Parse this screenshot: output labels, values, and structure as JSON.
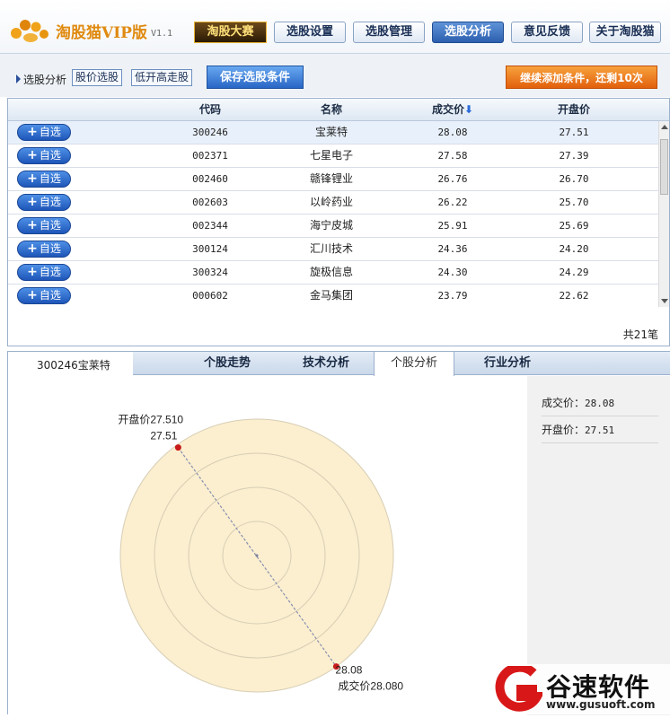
{
  "app": {
    "title": "淘股猫VIP版",
    "version": "V1.1",
    "contest_label": "淘股大赛",
    "nav": [
      {
        "label": "选股设置",
        "active": false
      },
      {
        "label": "选股管理",
        "active": false
      },
      {
        "label": "选股分析",
        "active": true
      },
      {
        "label": "意见反馈",
        "active": false
      },
      {
        "label": "关于淘股猫",
        "active": false
      }
    ]
  },
  "toolbar": {
    "label": "选股分析",
    "tags": [
      "股价选股",
      "低开高走股"
    ],
    "save_label": "保存选股条件",
    "add_condition_label": "继续添加条件，还剩10次"
  },
  "table": {
    "columns": {
      "code": "代码",
      "name": "名称",
      "price": "成交价",
      "open": "开盘价"
    },
    "sort_indicator": "⬇",
    "add_label": "自选",
    "add_icon": "plus-icon",
    "rows": [
      {
        "code": "300246",
        "name": "宝莱特",
        "price": "28.08",
        "open": "27.51"
      },
      {
        "code": "002371",
        "name": "七星电子",
        "price": "27.58",
        "open": "27.39"
      },
      {
        "code": "002460",
        "name": "赣锋锂业",
        "price": "26.76",
        "open": "26.70"
      },
      {
        "code": "002603",
        "name": "以岭药业",
        "price": "26.22",
        "open": "25.70"
      },
      {
        "code": "002344",
        "name": "海宁皮城",
        "price": "25.91",
        "open": "25.69"
      },
      {
        "code": "300124",
        "name": "汇川技术",
        "price": "24.36",
        "open": "24.20"
      },
      {
        "code": "300324",
        "name": "旋极信息",
        "price": "24.30",
        "open": "24.29"
      },
      {
        "code": "000602",
        "name": "金马集团",
        "price": "23.79",
        "open": "22.62"
      }
    ],
    "total": "共21笔"
  },
  "analysis": {
    "stock_label": "300246宝莱特",
    "tabs": [
      {
        "label": "个股走势",
        "active": false
      },
      {
        "label": "技术分析",
        "active": false
      },
      {
        "label": "个股分析",
        "active": true
      },
      {
        "label": "行业分析",
        "active": false
      }
    ],
    "side": [
      {
        "label": "成交价：",
        "value": "28.08"
      },
      {
        "label": "开盘价：",
        "value": "27.51"
      }
    ]
  },
  "chart_data": {
    "type": "radar",
    "axes": [
      {
        "name": "开盘价",
        "value": 27.51,
        "label": "开盘价27.510",
        "point_label": "27.51"
      },
      {
        "name": "成交价",
        "value": 28.08,
        "label": "成交价28.080",
        "point_label": "28.08"
      }
    ],
    "rings": 4,
    "colors": {
      "fill": "#fbefcf",
      "ring": "#d7cdb4",
      "point": "#c81a1a",
      "line": "#8a8fb0"
    }
  },
  "watermark": {
    "brand": "谷速软件",
    "url": "www.gusuoft.com"
  },
  "colors": {
    "accent": "#2c5fae",
    "orange": "#e2600c",
    "logo": "#e08a10"
  }
}
